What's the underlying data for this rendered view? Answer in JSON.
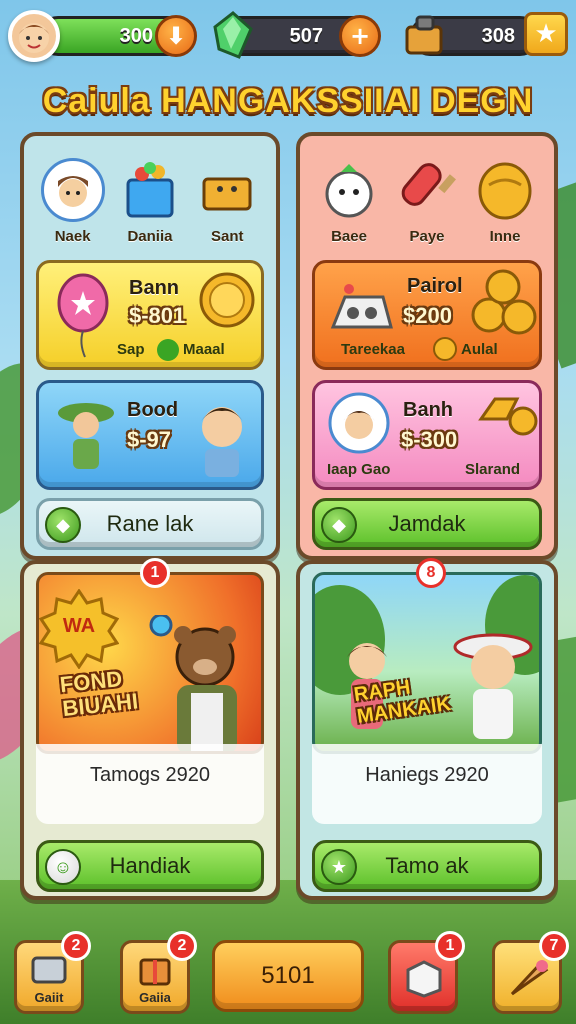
{
  "top_bar": {
    "resource_1": {
      "value": "300",
      "icon": "heart-coin-icon"
    },
    "resource_2": {
      "value": "507",
      "icon": "green-gem-icon"
    },
    "resource_3": {
      "value": "308",
      "icon": "toolbox-icon"
    }
  },
  "title": "Caiula HANGAKSSIIAI DEGN",
  "left_panel": {
    "categories": [
      {
        "label": "Naek",
        "icon": "character-portrait-icon"
      },
      {
        "label": "Daniia",
        "icon": "gift-box-icon"
      },
      {
        "label": "Sant",
        "icon": "chest-icon"
      }
    ],
    "offer_1": {
      "name": "Bann",
      "price": "$-801",
      "sub_left": "Sap",
      "sub_right": "Maaal"
    },
    "offer_2": {
      "name": "Bood",
      "price": "$-97"
    },
    "button": "Rane lak"
  },
  "right_panel": {
    "categories": [
      {
        "label": "Baee",
        "icon": "snow-spirit-icon"
      },
      {
        "label": "Paye",
        "icon": "popsicle-icon"
      },
      {
        "label": "Inne",
        "icon": "golden-egg-icon"
      }
    ],
    "offer_1": {
      "name": "Pairol",
      "price": "$200",
      "sub_left": "Tareekaa",
      "sub_right": "Aulal"
    },
    "offer_2": {
      "name": "Banh",
      "price": "$-300",
      "sub_left": "Iaap Gao",
      "sub_right": "Slarand"
    },
    "button": "Jamdak"
  },
  "event_left": {
    "art_badge": "WA",
    "art_text": "FOND BIUAHI",
    "corner_badge": "1",
    "date": "Tamogs 2920",
    "button": "Handiak"
  },
  "event_right": {
    "art_text": "RAPH MANKAIK",
    "corner_badge": "8",
    "date": "Haniegs 2920",
    "button": "Tamo ak"
  },
  "bottom_nav": {
    "left_1": {
      "label": "Gaiit",
      "badge": "2"
    },
    "left_2": {
      "label": "Gaiia",
      "badge": "2"
    },
    "center": "5101",
    "right_1": {
      "badge": "1"
    },
    "right_2": {
      "badge": "7"
    }
  }
}
